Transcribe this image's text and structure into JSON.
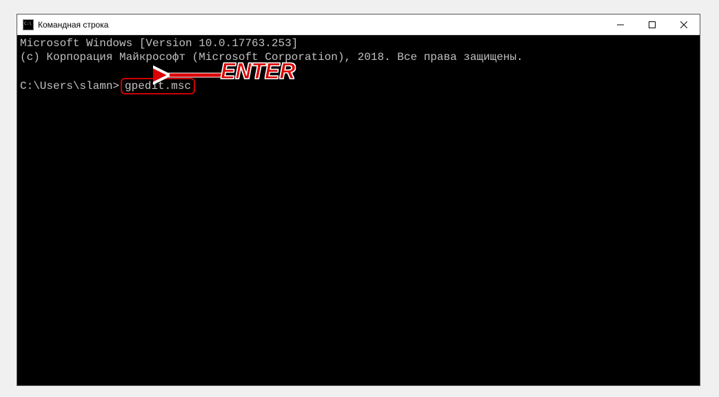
{
  "window": {
    "title": "Командная строка"
  },
  "console": {
    "line1": "Microsoft Windows [Version 10.0.17763.253]",
    "line2": "(c) Корпорация Майкрософт (Microsoft Corporation), 2018. Все права защищены.",
    "prompt": "C:\\Users\\slamn>",
    "command": "gpedit.msc"
  },
  "annotation": {
    "label": "ENTER"
  }
}
